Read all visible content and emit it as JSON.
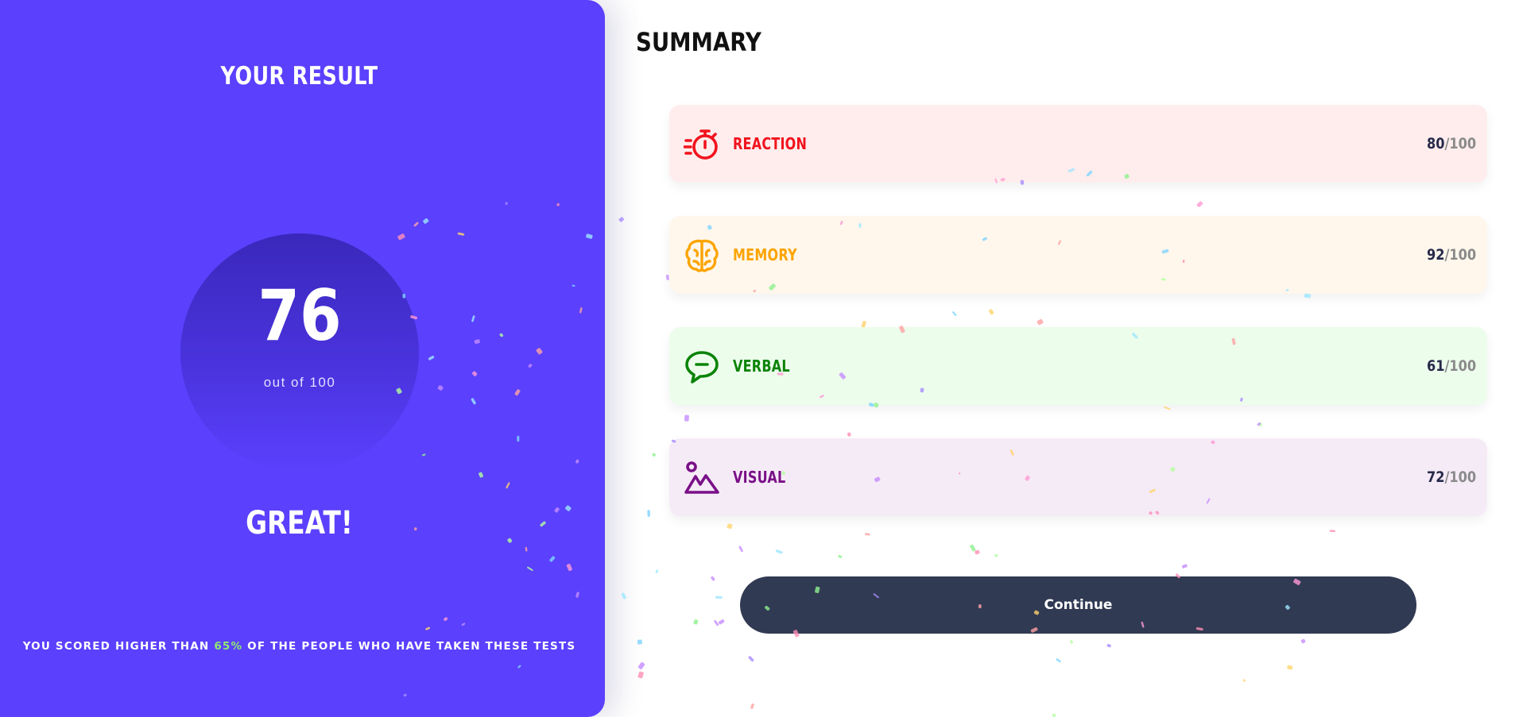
{
  "result": {
    "title": "YOUR RESULT",
    "score": "76",
    "score_caption": "out of 100",
    "verdict": "GREAT!",
    "percentile_prefix": "YOU SCORED HIGHER THAN ",
    "percentile_value": "65%",
    "percentile_suffix": " OF THE PEOPLE WHO HAVE TAKEN THESE TESTS"
  },
  "summary": {
    "title": "SUMMARY",
    "items": [
      {
        "label": "REACTION",
        "score": "80",
        "max": "/100",
        "icon": "stopwatch-icon",
        "color": "#f1131d",
        "background": "#ffeded"
      },
      {
        "label": "MEMORY",
        "score": "92",
        "max": "/100",
        "icon": "brain-icon",
        "color": "#fca400",
        "background": "#fff7ec"
      },
      {
        "label": "VERBAL",
        "score": "61",
        "max": "/100",
        "icon": "speech-bubble-icon",
        "color": "#0b8306",
        "background": "#ecfdec"
      },
      {
        "label": "VISUAL",
        "score": "72",
        "max": "/100",
        "icon": "image-icon",
        "color": "#7a0f88",
        "background": "#f5ebf6"
      }
    ]
  },
  "continue_label": "Continue",
  "colors": {
    "panel": "#5b40fd",
    "accent_green": "#8eea6b",
    "button": "#313a53"
  }
}
